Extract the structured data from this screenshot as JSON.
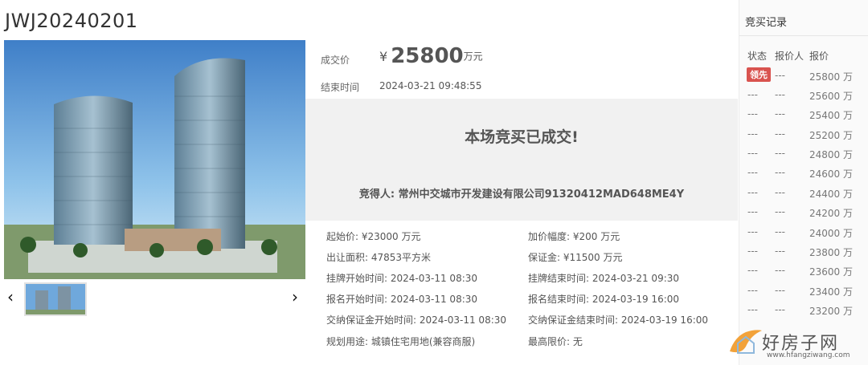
{
  "lot": {
    "title": "JWJ20240201"
  },
  "price": {
    "label": "成交价",
    "symbol": "¥",
    "value": "25800",
    "unit": "万元",
    "end_label": "结束时间",
    "end_value": "2024-03-21 09:48:55"
  },
  "result": {
    "title": "本场竞买已成交!",
    "winner_label": "竞得人:",
    "winner_value": "常州中交城市开发建设有限公司91320412MAD648ME4Y"
  },
  "info": {
    "start_price_label": "起始价:",
    "start_price_value": "¥23000 万元",
    "increment_label": "加价幅度:",
    "increment_value": "¥200 万元",
    "area_label": "出让面积:",
    "area_value": "47853平方米",
    "deposit_label": "保证金:",
    "deposit_value": "¥11500 万元",
    "listing_start_label": "挂牌开始时间:",
    "listing_start_value": "2024-03-11 08:30",
    "listing_end_label": "挂牌结束时间:",
    "listing_end_value": "2024-03-21 09:30",
    "reg_start_label": "报名开始时间:",
    "reg_start_value": "2024-03-11 08:30",
    "reg_end_label": "报名结束时间:",
    "reg_end_value": "2024-03-19 16:00",
    "dep_start_label": "交纳保证金开始时间:",
    "dep_start_value": "2024-03-11 08:30",
    "dep_end_label": "交纳保证金结束时间:",
    "dep_end_value": "2024-03-19 16:00",
    "usage_label": "规划用途:",
    "usage_value": "城镇住宅用地(兼容商服)",
    "max_price_label": "最高限价:",
    "max_price_value": "无"
  },
  "bids": {
    "title": "竞买记录",
    "head": [
      "状态",
      "报价人",
      "报价"
    ],
    "rows": [
      [
        "领先",
        "---",
        "25800 万"
      ],
      [
        "---",
        "---",
        "25600 万"
      ],
      [
        "---",
        "---",
        "25400 万"
      ],
      [
        "---",
        "---",
        "25200 万"
      ],
      [
        "---",
        "---",
        "24800 万"
      ],
      [
        "---",
        "---",
        "24600 万"
      ],
      [
        "---",
        "---",
        "24400 万"
      ],
      [
        "---",
        "---",
        "24200 万"
      ],
      [
        "---",
        "---",
        "24000 万"
      ],
      [
        "---",
        "---",
        "23800 万"
      ],
      [
        "---",
        "---",
        "23600 万"
      ],
      [
        "---",
        "---",
        "23400 万"
      ],
      [
        "---",
        "---",
        "23200 万"
      ]
    ]
  },
  "nav": {
    "prev": "‹",
    "next": "›"
  },
  "watermark": {
    "text": "好房子网",
    "url": "www.hfangziwang.com"
  },
  "colors": {
    "lead_badge": "#d9534f",
    "result_bg": "#f1f1f1"
  }
}
